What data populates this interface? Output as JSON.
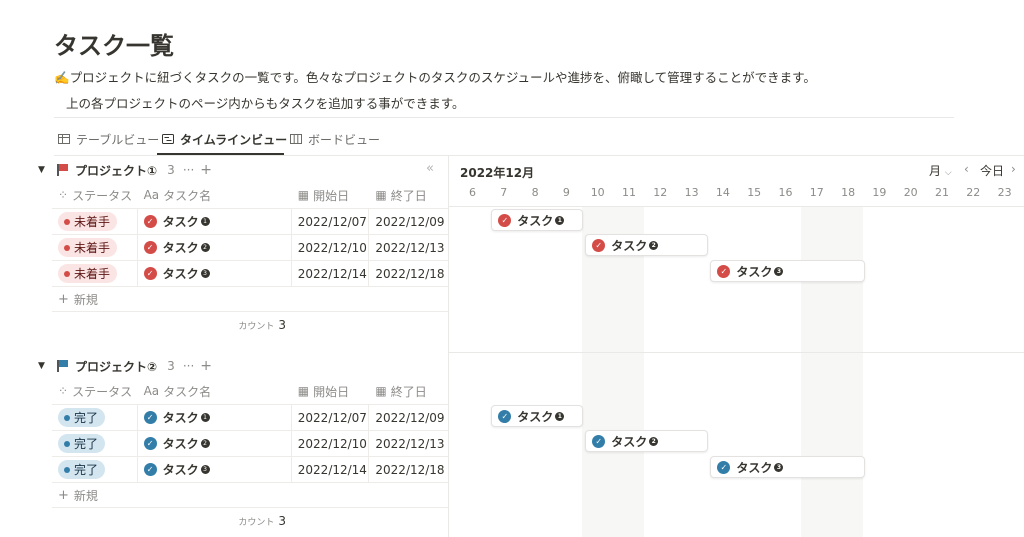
{
  "page": {
    "title": "タスク一覧",
    "description_line1": "✍️プロジェクトに紐づくタスクの一覧です。色々なプロジェクトのタスクのスケジュールや進捗を、俯瞰して管理することができます。",
    "description_line2": "上の各プロジェクトのページ内からもタスクを追加する事ができます。"
  },
  "tabs": [
    {
      "label": "テーブルビュー",
      "icon": "table-icon",
      "active": false
    },
    {
      "label": "タイムラインビュー",
      "icon": "timeline-icon",
      "active": true
    },
    {
      "label": "ボードビュー",
      "icon": "board-icon",
      "active": false
    }
  ],
  "columns": {
    "status": "ステータス",
    "name_prefix": "Aa",
    "name": "タスク名",
    "start": "開始日",
    "end": "終了日"
  },
  "groups": [
    {
      "name": "プロジェクト①",
      "flag_color": "#d44c47",
      "count": "3",
      "rows": [
        {
          "status": "未着手",
          "task": "タスク",
          "num": "1",
          "start": "2022/12/07",
          "end": "2022/12/09"
        },
        {
          "status": "未着手",
          "task": "タスク",
          "num": "2",
          "start": "2022/12/10",
          "end": "2022/12/13"
        },
        {
          "status": "未着手",
          "task": "タスク",
          "num": "3",
          "start": "2022/12/14",
          "end": "2022/12/18"
        }
      ],
      "new_label": "新規",
      "count_label": "カウント",
      "count_value": "3"
    },
    {
      "name": "プロジェクト②",
      "flag_color": "#337ea9",
      "count": "3",
      "rows": [
        {
          "status": "完了",
          "task": "タスク",
          "num": "1",
          "start": "2022/12/07",
          "end": "2022/12/09"
        },
        {
          "status": "完了",
          "task": "タスク",
          "num": "2",
          "start": "2022/12/10",
          "end": "2022/12/13"
        },
        {
          "status": "完了",
          "task": "タスク",
          "num": "3",
          "start": "2022/12/14",
          "end": "2022/12/18"
        }
      ],
      "new_label": "新規",
      "count_label": "カウント",
      "count_value": "3"
    }
  ],
  "timeline": {
    "month_label": "2022年12月",
    "scale_label": "月",
    "today_label": "今日",
    "days": [
      "6",
      "7",
      "8",
      "9",
      "10",
      "11",
      "12",
      "13",
      "14",
      "15",
      "16",
      "17",
      "18",
      "19",
      "20",
      "21",
      "22",
      "23"
    ]
  },
  "colors": {
    "todo": "#d44c47",
    "done": "#337ea9",
    "weekend_shade": "#f7f7f5"
  }
}
